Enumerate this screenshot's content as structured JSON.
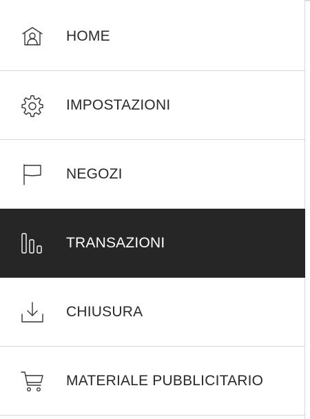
{
  "menu": {
    "items": [
      {
        "label": "HOME",
        "icon": "home-icon",
        "active": false
      },
      {
        "label": "IMPOSTAZIONI",
        "icon": "gear-icon",
        "active": false
      },
      {
        "label": "NEGOZI",
        "icon": "flag-icon",
        "active": false
      },
      {
        "label": "TRANSAZIONI",
        "icon": "bar-chart-icon",
        "active": true
      },
      {
        "label": "CHIUSURA",
        "icon": "download-icon",
        "active": false
      },
      {
        "label": "MATERIALE PUBBLICITARIO",
        "icon": "cart-icon",
        "active": false
      }
    ]
  },
  "colors": {
    "active_background": "#262626",
    "active_text": "#ffffff",
    "text": "#2a2a2a",
    "divider": "#d7d7d7"
  }
}
